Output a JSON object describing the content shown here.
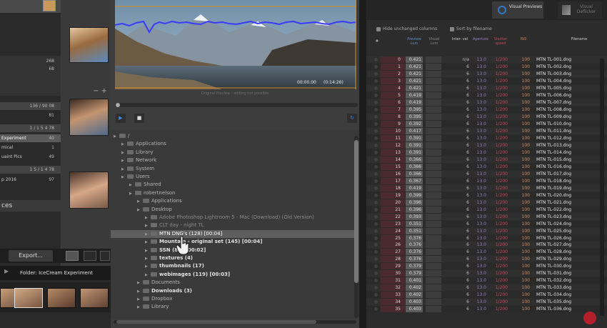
{
  "lightroom": {
    "counts": [
      "268",
      "68"
    ],
    "bars": [
      "136 / 90 08",
      "1 / 1 5 4 78",
      "1 5 / 1 4 78"
    ],
    "items": [
      {
        "label": "",
        "count": "81"
      },
      {
        "label": "Experiment",
        "count": "40"
      },
      {
        "label": "mical",
        "count": "1"
      },
      {
        "label": "uaint Pics",
        "count": "49"
      },
      {
        "label": "p 2016",
        "count": "97"
      }
    ],
    "section_title": "ces",
    "export_label": "Export...",
    "folder_label": "Folder: IceCream Experiment"
  },
  "timelapse": {
    "preview_caption": "Original Preview - editing not possible",
    "timecode_start": "00:00.00",
    "timecode_end": "(0:14:26)",
    "play_icon": "play-icon",
    "stop_icon": "stop-icon",
    "refresh_icon": "refresh-icon",
    "tree": [
      {
        "label": "/",
        "depth": 0,
        "style": "normal"
      },
      {
        "label": "Applications",
        "depth": 1,
        "style": "normal"
      },
      {
        "label": "Library",
        "depth": 1,
        "style": "normal"
      },
      {
        "label": "Network",
        "depth": 1,
        "style": "normal"
      },
      {
        "label": "System",
        "depth": 1,
        "style": "normal"
      },
      {
        "label": "Users",
        "depth": 1,
        "style": "normal"
      },
      {
        "label": "Shared",
        "depth": 2,
        "style": "normal"
      },
      {
        "label": "robertnelson",
        "depth": 2,
        "style": "normal"
      },
      {
        "label": "Applications",
        "depth": 3,
        "style": "normal"
      },
      {
        "label": "Desktop",
        "depth": 3,
        "style": "normal"
      },
      {
        "label": "Adobe Photoshop Lightroom 5 - Mac (Download) (Old Version)",
        "depth": 4,
        "style": "faint"
      },
      {
        "label": "CLT day - night TL",
        "depth": 4,
        "style": "faint"
      },
      {
        "label": "MTN DNG's (128) [00:04]",
        "depth": 4,
        "style": "sel"
      },
      {
        "label": "Mountain - original set (145) [00:04]",
        "depth": 4,
        "style": "bold"
      },
      {
        "label": "SSN (81) [00:02]",
        "depth": 4,
        "style": "bold"
      },
      {
        "label": "textures (4)",
        "depth": 4,
        "style": "bold"
      },
      {
        "label": "thumbnails (17)",
        "depth": 4,
        "style": "bold"
      },
      {
        "label": "webimages (119) [00:03]",
        "depth": 4,
        "style": "bold"
      },
      {
        "label": "Documents",
        "depth": 3,
        "style": "normal"
      },
      {
        "label": "Downloads (3)",
        "depth": 3,
        "style": "bold"
      },
      {
        "label": "Dropbox",
        "depth": 3,
        "style": "normal"
      },
      {
        "label": "Library",
        "depth": 3,
        "style": "normal"
      }
    ]
  },
  "table": {
    "mode_visual": "Visual Previews",
    "mode_visual_icon": "target-icon",
    "mode_deflicker": "Visual Deflicker",
    "opt_hide": "Hide unchanged columns",
    "opt_sort": "Sort by filename",
    "headers": [
      "#",
      "Preview Lum",
      "Visual Lum",
      "Inter- val",
      "Aperture",
      "Shutter speed",
      "ISO",
      "Filename"
    ],
    "rows": [
      [
        "0",
        "0.421",
        "n/a",
        "13.0",
        "1/200",
        "100",
        "MTN TL-001.dng"
      ],
      [
        "1",
        "0.421",
        "6",
        "13.0",
        "1/200",
        "100",
        "MTN TL-002.dng"
      ],
      [
        "2",
        "0.421",
        "6",
        "13.0",
        "1/200",
        "100",
        "MTN TL-003.dng"
      ],
      [
        "3",
        "0.421",
        "6",
        "13.0",
        "1/200",
        "100",
        "MTN TL-004.dng"
      ],
      [
        "4",
        "0.421",
        "6",
        "13.0",
        "1/200",
        "100",
        "MTN TL-005.dng"
      ],
      [
        "5",
        "0.419",
        "6",
        "13.0",
        "1/200",
        "100",
        "MTN TL-006.dng"
      ],
      [
        "6",
        "0.419",
        "6",
        "13.0",
        "1/200",
        "100",
        "MTN TL-007.dng"
      ],
      [
        "7",
        "0.395",
        "6",
        "13.0",
        "1/200",
        "100",
        "MTN TL-008.dng"
      ],
      [
        "8",
        "0.395",
        "6",
        "13.0",
        "1/200",
        "100",
        "MTN TL-009.dng"
      ],
      [
        "9",
        "0.392",
        "6",
        "13.0",
        "1/200",
        "100",
        "MTN TL-010.dng"
      ],
      [
        "10",
        "0.417",
        "6",
        "13.0",
        "1/200",
        "100",
        "MTN TL-011.dng"
      ],
      [
        "11",
        "0.391",
        "6",
        "13.0",
        "1/200",
        "100",
        "MTN TL-012.dng"
      ],
      [
        "12",
        "0.391",
        "6",
        "13.0",
        "1/200",
        "100",
        "MTN TL-013.dng"
      ],
      [
        "13",
        "0.391",
        "6",
        "13.0",
        "1/200",
        "100",
        "MTN TL-014.dng"
      ],
      [
        "14",
        "0.366",
        "6",
        "13.0",
        "1/200",
        "100",
        "MTN TL-015.dng"
      ],
      [
        "15",
        "0.366",
        "6",
        "13.0",
        "1/200",
        "100",
        "MTN TL-016.dng"
      ],
      [
        "16",
        "0.366",
        "6",
        "13.0",
        "1/200",
        "100",
        "MTN TL-017.dng"
      ],
      [
        "17",
        "0.367",
        "6",
        "13.0",
        "1/200",
        "100",
        "MTN TL-018.dng"
      ],
      [
        "18",
        "0.419",
        "6",
        "13.0",
        "1/200",
        "100",
        "MTN TL-019.dng"
      ],
      [
        "19",
        "0.399",
        "6",
        "13.0",
        "1/200",
        "100",
        "MTN TL-020.dng"
      ],
      [
        "20",
        "0.396",
        "6",
        "13.0",
        "1/200",
        "100",
        "MTN TL-021.dng"
      ],
      [
        "21",
        "0.396",
        "6",
        "13.0",
        "1/200",
        "100",
        "MTN TL-022.dng"
      ],
      [
        "22",
        "0.393",
        "6",
        "13.0",
        "1/200",
        "100",
        "MTN TL-023.dng"
      ],
      [
        "23",
        "0.351",
        "6",
        "13.0",
        "1/200",
        "100",
        "MTN TL-024.dng"
      ],
      [
        "24",
        "0.351",
        "6",
        "13.0",
        "1/200",
        "100",
        "MTN TL-025.dng"
      ],
      [
        "25",
        "0.376",
        "6",
        "13.0",
        "1/200",
        "100",
        "MTN TL-026.dng"
      ],
      [
        "26",
        "0.376",
        "6",
        "13.0",
        "1/200",
        "100",
        "MTN TL-027.dng"
      ],
      [
        "27",
        "0.376",
        "6",
        "13.0",
        "1/200",
        "100",
        "MTN TL-028.dng"
      ],
      [
        "28",
        "0.376",
        "6",
        "13.0",
        "1/200",
        "100",
        "MTN TL-029.dng"
      ],
      [
        "29",
        "0.379",
        "6",
        "13.0",
        "1/200",
        "100",
        "MTN TL-030.dng"
      ],
      [
        "30",
        "0.379",
        "6",
        "13.0",
        "1/200",
        "100",
        "MTN TL-031.dng"
      ],
      [
        "31",
        "0.401",
        "6",
        "13.0",
        "1/200",
        "100",
        "MTN TL-032.dng"
      ],
      [
        "32",
        "0.402",
        "6",
        "13.0",
        "1/200",
        "100",
        "MTN TL-033.dng"
      ],
      [
        "33",
        "0.402",
        "6",
        "13.0",
        "1/200",
        "100",
        "MTN TL-034.dng"
      ],
      [
        "34",
        "0.403",
        "6",
        "13.0",
        "1/200",
        "100",
        "MTN TL-035.dng"
      ],
      [
        "35",
        "0.403",
        "6",
        "13.0",
        "1/200",
        "100",
        "MTN TL-036.dng"
      ]
    ]
  }
}
